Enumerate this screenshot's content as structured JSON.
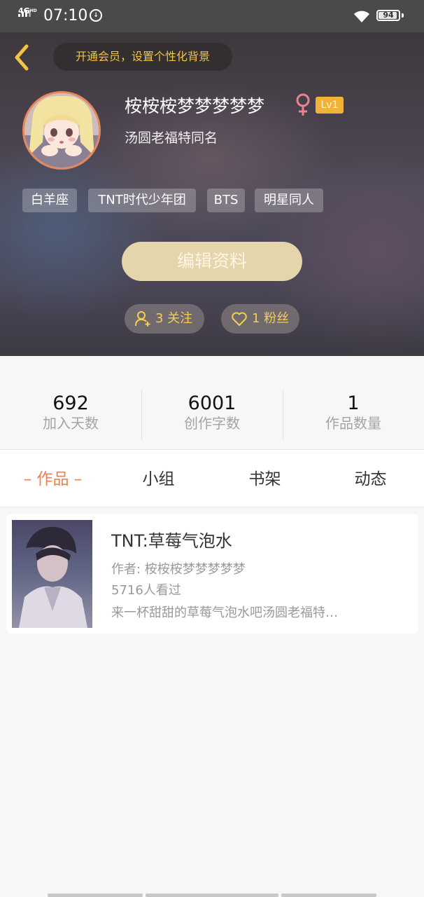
{
  "status_bar": {
    "network": "4G",
    "network_sup": "HD",
    "time": "07:10",
    "battery": "94",
    "battery_level": 0.94
  },
  "header": {
    "vip_prompt": "开通会员，设置个性化背景",
    "username": "桉桉桉梦梦梦梦梦",
    "gender_icon": "female-icon",
    "gender_color": "#e8848e",
    "level": "Lv1",
    "level_color": "#f2b23a",
    "signature": "汤圆老福特同名",
    "tags": [
      "白羊座",
      "TNT时代少年团",
      "BTS",
      "明星同人"
    ],
    "edit_button": "编辑资料",
    "following": "3 关注",
    "followers": "1 粉丝"
  },
  "stats": [
    {
      "value": "692",
      "label": "加入天数"
    },
    {
      "value": "6001",
      "label": "创作字数"
    },
    {
      "value": "1",
      "label": "作品数量"
    }
  ],
  "tabs": [
    {
      "label": "– 作品 –",
      "active": true
    },
    {
      "label": "小组",
      "active": false
    },
    {
      "label": "书架",
      "active": false
    },
    {
      "label": "动态",
      "active": false
    }
  ],
  "accent_color": "#ec8250",
  "works": [
    {
      "title": "TNT:草莓气泡水",
      "author": "作者: 桉桉桉梦梦梦梦梦",
      "views": "5716人看过",
      "description": "来一杯甜甜的草莓气泡水吧汤圆老福特…"
    }
  ]
}
